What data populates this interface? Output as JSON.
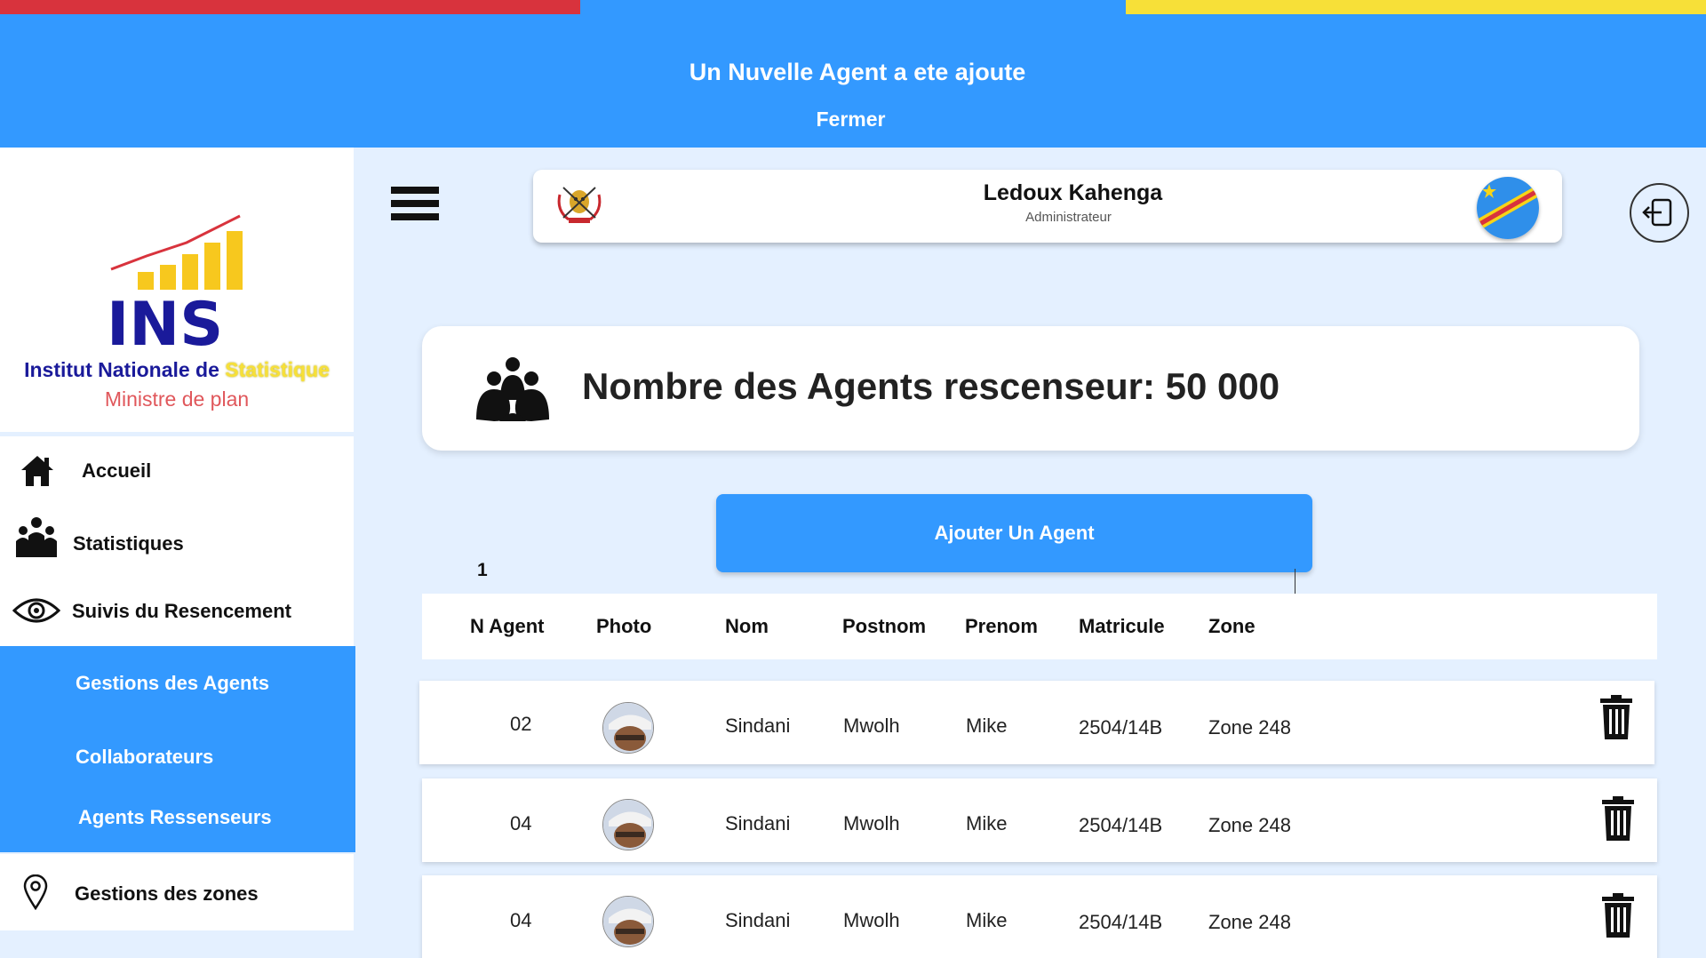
{
  "banner": {
    "message": "Un Nuvelle Agent a ete ajoute",
    "close_label": "Fermer"
  },
  "brand": {
    "logo_text": "INS",
    "name_part1": "Institut Nationale de",
    "name_part2": "Statistique",
    "subtitle": "Ministre de plan"
  },
  "nav": {
    "home": "Accueil",
    "stats": "Statistiques",
    "tracking": "Suivis du Resencement",
    "sub": [
      "Gestions des Agents",
      "Collaborateurs",
      "Agents Ressenseurs"
    ],
    "zones": "Gestions des zones"
  },
  "user": {
    "name": "Ledoux Kahenga",
    "role": "Administrateur"
  },
  "stat": {
    "text": "Nombre des Agents rescenseur: 50 000"
  },
  "add_button": "Ajouter Un Agent",
  "pagination": {
    "current": "1"
  },
  "table": {
    "headers": [
      "N Agent",
      "Photo",
      "Nom",
      "Postnom",
      "Prenom",
      "Matricule",
      "Zone"
    ],
    "rows": [
      {
        "num": "02",
        "nom": "Sindani",
        "postnom": "Mwolh",
        "prenom": "Mike",
        "matricule": "2504/14B",
        "zone": "Zone 248"
      },
      {
        "num": "04",
        "nom": "Sindani",
        "postnom": "Mwolh",
        "prenom": "Mike",
        "matricule": "2504/14B",
        "zone": "Zone 248"
      },
      {
        "num": "04",
        "nom": "Sindani",
        "postnom": "Mwolh",
        "prenom": "Mike",
        "matricule": "2504/14B",
        "zone": "Zone 248"
      }
    ]
  },
  "colors": {
    "accent": "#3399ff",
    "flag_red": "#d8333d",
    "flag_yellow": "#f7e038",
    "background": "#e4f0ff"
  },
  "icons": [
    "menu-icon",
    "home-icon",
    "group-icon",
    "eye-icon",
    "location-pin-icon",
    "logout-icon",
    "trash-icon",
    "coat-of-arms-icon",
    "drc-flag-icon"
  ]
}
